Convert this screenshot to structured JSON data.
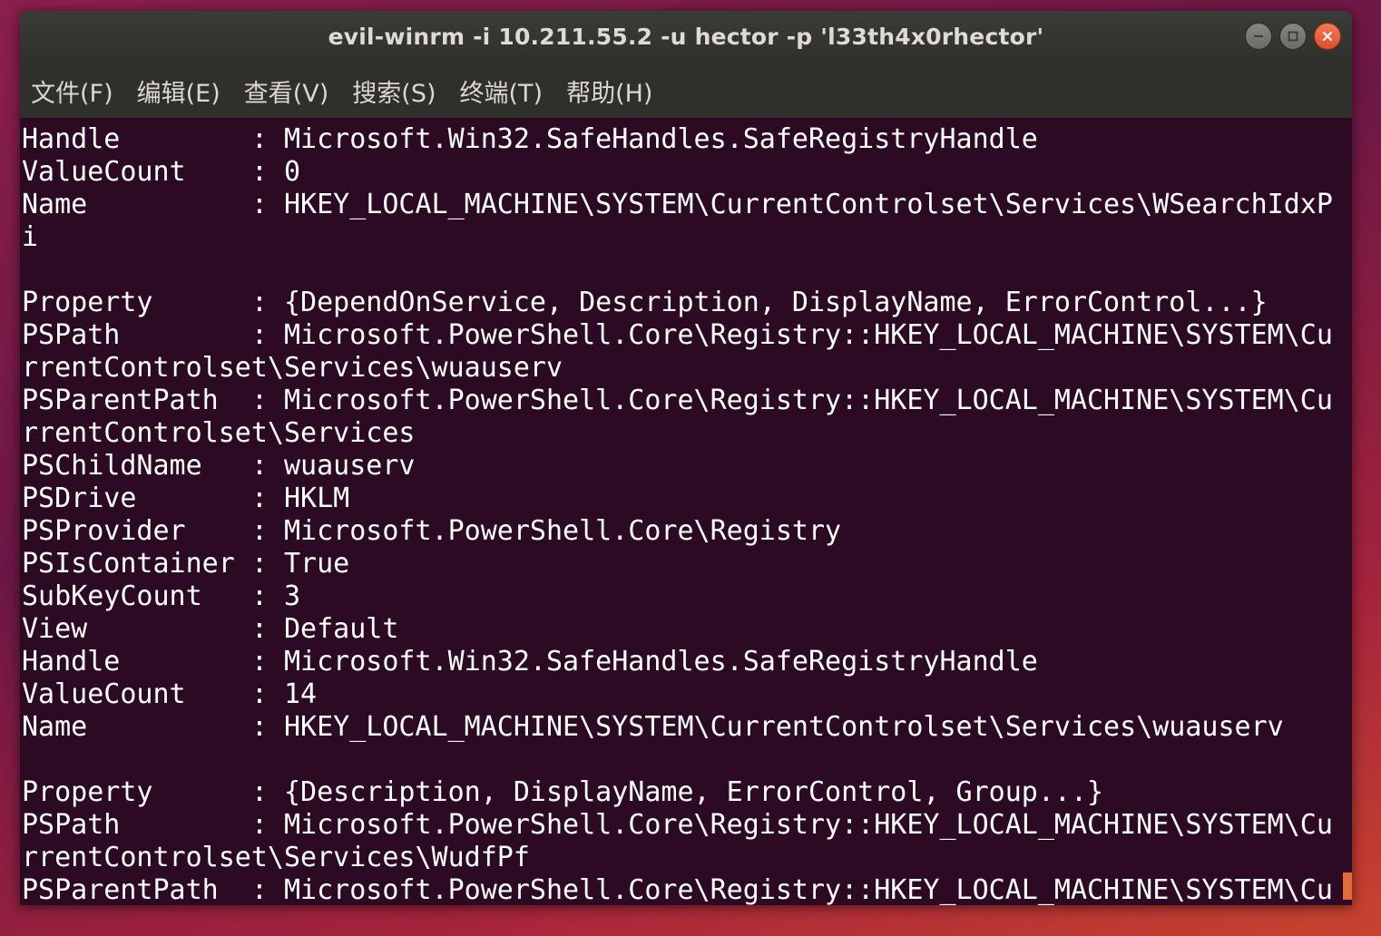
{
  "window": {
    "title": "evil-winrm -i 10.211.55.2 -u hector -p 'l33th4x0rhector'",
    "buttons": {
      "minimize_icon": "minimize-icon",
      "maximize_icon": "maximize-icon",
      "close_icon": "close-icon"
    }
  },
  "menu": [
    "文件(F)",
    "编辑(E)",
    "查看(V)",
    "搜索(S)",
    "终端(T)",
    "帮助(H)"
  ],
  "terminal": {
    "lines": [
      "Handle        : Microsoft.Win32.SafeHandles.SafeRegistryHandle",
      "ValueCount    : 0",
      "Name          : HKEY_LOCAL_MACHINE\\SYSTEM\\CurrentControlset\\Services\\WSearchIdxP",
      "i",
      "",
      "Property      : {DependOnService, Description, DisplayName, ErrorControl...}",
      "PSPath        : Microsoft.PowerShell.Core\\Registry::HKEY_LOCAL_MACHINE\\SYSTEM\\Cu",
      "rrentControlset\\Services\\wuauserv",
      "PSParentPath  : Microsoft.PowerShell.Core\\Registry::HKEY_LOCAL_MACHINE\\SYSTEM\\Cu",
      "rrentControlset\\Services",
      "PSChildName   : wuauserv",
      "PSDrive       : HKLM",
      "PSProvider    : Microsoft.PowerShell.Core\\Registry",
      "PSIsContainer : True",
      "SubKeyCount   : 3",
      "View          : Default",
      "Handle        : Microsoft.Win32.SafeHandles.SafeRegistryHandle",
      "ValueCount    : 14",
      "Name          : HKEY_LOCAL_MACHINE\\SYSTEM\\CurrentControlset\\Services\\wuauserv",
      "",
      "Property      : {Description, DisplayName, ErrorControl, Group...}",
      "PSPath        : Microsoft.PowerShell.Core\\Registry::HKEY_LOCAL_MACHINE\\SYSTEM\\Cu",
      "rrentControlset\\Services\\WudfPf",
      "PSParentPath  : Microsoft.PowerShell.Core\\Registry::HKEY_LOCAL_MACHINE\\SYSTEM\\Cu"
    ]
  },
  "colors": {
    "terminal_bg": "#2c0a24",
    "terminal_fg": "#ffffff",
    "titlebar_bg": "#3b3b37",
    "close_button": "#e9643a",
    "cursor": "#e06c3c"
  }
}
